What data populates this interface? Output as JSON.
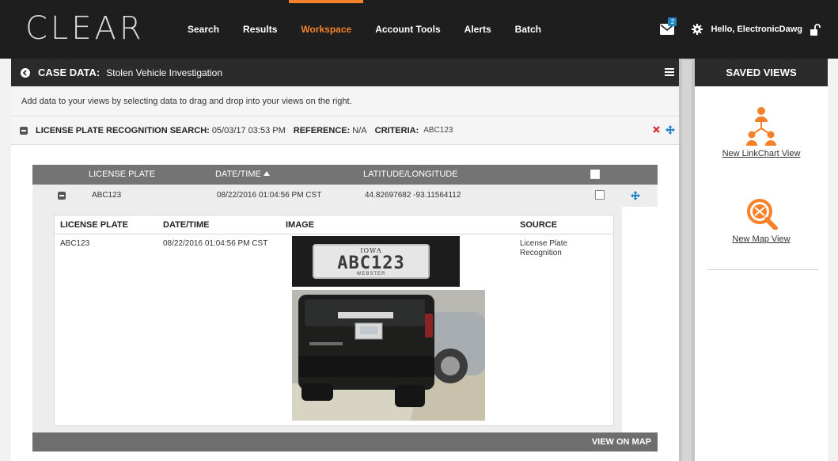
{
  "app": {
    "logo": "CLEAR"
  },
  "nav": {
    "items": [
      {
        "label": "Search",
        "active": false
      },
      {
        "label": "Results",
        "active": false
      },
      {
        "label": "Workspace",
        "active": true
      },
      {
        "label": "Account Tools",
        "active": false
      },
      {
        "label": "Alerts",
        "active": false
      },
      {
        "label": "Batch",
        "active": false
      }
    ],
    "mail_badge": "2",
    "greeting": "Hello, ElectronicDawg",
    "accent_color": "#f5822a"
  },
  "case": {
    "label": "CASE DATA:",
    "name": "Stolen Vehicle Investigation",
    "instruction": "Add data to your views by selecting data to drag and drop into your views on the right."
  },
  "search": {
    "label": "LICENSE PLATE RECOGNITION SEARCH:",
    "datetime": "05/03/17 03:53 PM",
    "reference_label": "REFERENCE:",
    "reference_value": "N/A",
    "criteria_label": "CRITERIA:",
    "criteria_value": "ABC123"
  },
  "results": {
    "columns": [
      "LICENSE PLATE",
      "DATE/TIME",
      "LATITUDE/LONGITUDE"
    ],
    "sort_column": "DATE/TIME",
    "row": {
      "plate": "ABC123",
      "datetime": "08/22/2016 01:04:56 PM CST",
      "latlong": "44.82697682 -93.11564112"
    },
    "detail": {
      "columns": [
        "LICENSE PLATE",
        "DATE/TIME",
        "IMAGE",
        "SOURCE"
      ],
      "plate": "ABC123",
      "datetime": "08/22/2016 01:04:56 PM CST",
      "source": "License Plate Recognition",
      "plate_image": {
        "state": "IOWA",
        "number": "ABC123",
        "county": "WEBSTER"
      }
    },
    "footer_action": "VIEW ON MAP"
  },
  "sidebar": {
    "title": "SAVED VIEWS",
    "views": [
      {
        "label": "New LinkChart View",
        "icon": "linkchart-icon"
      },
      {
        "label": "New Map View",
        "icon": "map-view-icon"
      }
    ]
  }
}
